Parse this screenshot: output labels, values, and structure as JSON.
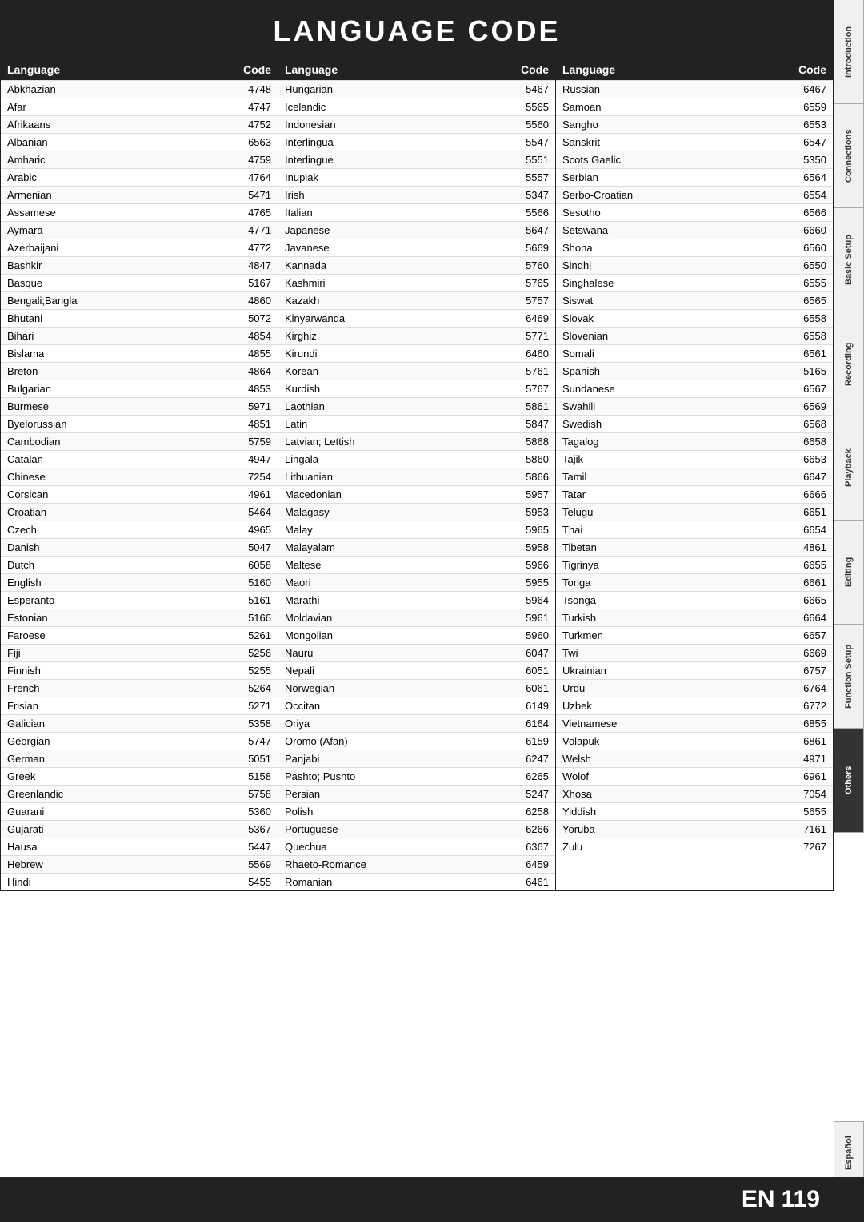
{
  "page": {
    "title": "LANGUAGE CODE",
    "bottom_label": "EN",
    "bottom_number": "119"
  },
  "sidebar": {
    "tabs": [
      {
        "label": "Introduction",
        "active": false
      },
      {
        "label": "Connections",
        "active": false
      },
      {
        "label": "Basic Setup",
        "active": false
      },
      {
        "label": "Recording",
        "active": false
      },
      {
        "label": "Playback",
        "active": false
      },
      {
        "label": "Editing",
        "active": false
      },
      {
        "label": "Function Setup",
        "active": false
      },
      {
        "label": "Others",
        "active": true
      },
      {
        "label": "Español",
        "active": false
      }
    ]
  },
  "columns": [
    {
      "header_lang": "Language",
      "header_code": "Code",
      "rows": [
        {
          "lang": "Abkhazian",
          "code": "4748"
        },
        {
          "lang": "Afar",
          "code": "4747"
        },
        {
          "lang": "Afrikaans",
          "code": "4752"
        },
        {
          "lang": "Albanian",
          "code": "6563"
        },
        {
          "lang": "Amharic",
          "code": "4759"
        },
        {
          "lang": "Arabic",
          "code": "4764"
        },
        {
          "lang": "Armenian",
          "code": "5471"
        },
        {
          "lang": "Assamese",
          "code": "4765"
        },
        {
          "lang": "Aymara",
          "code": "4771"
        },
        {
          "lang": "Azerbaijani",
          "code": "4772"
        },
        {
          "lang": "Bashkir",
          "code": "4847"
        },
        {
          "lang": "Basque",
          "code": "5167"
        },
        {
          "lang": "Bengali;Bangla",
          "code": "4860"
        },
        {
          "lang": "Bhutani",
          "code": "5072"
        },
        {
          "lang": "Bihari",
          "code": "4854"
        },
        {
          "lang": "Bislama",
          "code": "4855"
        },
        {
          "lang": "Breton",
          "code": "4864"
        },
        {
          "lang": "Bulgarian",
          "code": "4853"
        },
        {
          "lang": "Burmese",
          "code": "5971"
        },
        {
          "lang": "Byelorussian",
          "code": "4851"
        },
        {
          "lang": "Cambodian",
          "code": "5759"
        },
        {
          "lang": "Catalan",
          "code": "4947"
        },
        {
          "lang": "Chinese",
          "code": "7254"
        },
        {
          "lang": "Corsican",
          "code": "4961"
        },
        {
          "lang": "Croatian",
          "code": "5464"
        },
        {
          "lang": "Czech",
          "code": "4965"
        },
        {
          "lang": "Danish",
          "code": "5047"
        },
        {
          "lang": "Dutch",
          "code": "6058"
        },
        {
          "lang": "English",
          "code": "5160"
        },
        {
          "lang": "Esperanto",
          "code": "5161"
        },
        {
          "lang": "Estonian",
          "code": "5166"
        },
        {
          "lang": "Faroese",
          "code": "5261"
        },
        {
          "lang": "Fiji",
          "code": "5256"
        },
        {
          "lang": "Finnish",
          "code": "5255"
        },
        {
          "lang": "French",
          "code": "5264"
        },
        {
          "lang": "Frisian",
          "code": "5271"
        },
        {
          "lang": "Galician",
          "code": "5358"
        },
        {
          "lang": "Georgian",
          "code": "5747"
        },
        {
          "lang": "German",
          "code": "5051"
        },
        {
          "lang": "Greek",
          "code": "5158"
        },
        {
          "lang": "Greenlandic",
          "code": "5758"
        },
        {
          "lang": "Guarani",
          "code": "5360"
        },
        {
          "lang": "Gujarati",
          "code": "5367"
        },
        {
          "lang": "Hausa",
          "code": "5447"
        },
        {
          "lang": "Hebrew",
          "code": "5569"
        },
        {
          "lang": "Hindi",
          "code": "5455"
        }
      ]
    },
    {
      "header_lang": "Language",
      "header_code": "Code",
      "rows": [
        {
          "lang": "Hungarian",
          "code": "5467"
        },
        {
          "lang": "Icelandic",
          "code": "5565"
        },
        {
          "lang": "Indonesian",
          "code": "5560"
        },
        {
          "lang": "Interlingua",
          "code": "5547"
        },
        {
          "lang": "Interlingue",
          "code": "5551"
        },
        {
          "lang": "Inupiak",
          "code": "5557"
        },
        {
          "lang": "Irish",
          "code": "5347"
        },
        {
          "lang": "Italian",
          "code": "5566"
        },
        {
          "lang": "Japanese",
          "code": "5647"
        },
        {
          "lang": "Javanese",
          "code": "5669"
        },
        {
          "lang": "Kannada",
          "code": "5760"
        },
        {
          "lang": "Kashmiri",
          "code": "5765"
        },
        {
          "lang": "Kazakh",
          "code": "5757"
        },
        {
          "lang": "Kinyarwanda",
          "code": "6469"
        },
        {
          "lang": "Kirghiz",
          "code": "5771"
        },
        {
          "lang": "Kirundi",
          "code": "6460"
        },
        {
          "lang": "Korean",
          "code": "5761"
        },
        {
          "lang": "Kurdish",
          "code": "5767"
        },
        {
          "lang": "Laothian",
          "code": "5861"
        },
        {
          "lang": "Latin",
          "code": "5847"
        },
        {
          "lang": "Latvian; Lettish",
          "code": "5868"
        },
        {
          "lang": "Lingala",
          "code": "5860"
        },
        {
          "lang": "Lithuanian",
          "code": "5866"
        },
        {
          "lang": "Macedonian",
          "code": "5957"
        },
        {
          "lang": "Malagasy",
          "code": "5953"
        },
        {
          "lang": "Malay",
          "code": "5965"
        },
        {
          "lang": "Malayalam",
          "code": "5958"
        },
        {
          "lang": "Maltese",
          "code": "5966"
        },
        {
          "lang": "Maori",
          "code": "5955"
        },
        {
          "lang": "Marathi",
          "code": "5964"
        },
        {
          "lang": "Moldavian",
          "code": "5961"
        },
        {
          "lang": "Mongolian",
          "code": "5960"
        },
        {
          "lang": "Nauru",
          "code": "6047"
        },
        {
          "lang": "Nepali",
          "code": "6051"
        },
        {
          "lang": "Norwegian",
          "code": "6061"
        },
        {
          "lang": "Occitan",
          "code": "6149"
        },
        {
          "lang": "Oriya",
          "code": "6164"
        },
        {
          "lang": "Oromo (Afan)",
          "code": "6159"
        },
        {
          "lang": "Panjabi",
          "code": "6247"
        },
        {
          "lang": "Pashto; Pushto",
          "code": "6265"
        },
        {
          "lang": "Persian",
          "code": "5247"
        },
        {
          "lang": "Polish",
          "code": "6258"
        },
        {
          "lang": "Portuguese",
          "code": "6266"
        },
        {
          "lang": "Quechua",
          "code": "6367"
        },
        {
          "lang": "Rhaeto-Romance",
          "code": "6459"
        },
        {
          "lang": "Romanian",
          "code": "6461"
        }
      ]
    },
    {
      "header_lang": "Language",
      "header_code": "Code",
      "rows": [
        {
          "lang": "Russian",
          "code": "6467"
        },
        {
          "lang": "Samoan",
          "code": "6559"
        },
        {
          "lang": "Sangho",
          "code": "6553"
        },
        {
          "lang": "Sanskrit",
          "code": "6547"
        },
        {
          "lang": "Scots Gaelic",
          "code": "5350"
        },
        {
          "lang": "Serbian",
          "code": "6564"
        },
        {
          "lang": "Serbo-Croatian",
          "code": "6554"
        },
        {
          "lang": "Sesotho",
          "code": "6566"
        },
        {
          "lang": "Setswana",
          "code": "6660"
        },
        {
          "lang": "Shona",
          "code": "6560"
        },
        {
          "lang": "Sindhi",
          "code": "6550"
        },
        {
          "lang": "Singhalese",
          "code": "6555"
        },
        {
          "lang": "Siswat",
          "code": "6565"
        },
        {
          "lang": "Slovak",
          "code": "6558"
        },
        {
          "lang": "Slovenian",
          "code": "6558"
        },
        {
          "lang": "Somali",
          "code": "6561"
        },
        {
          "lang": "Spanish",
          "code": "5165"
        },
        {
          "lang": "Sundanese",
          "code": "6567"
        },
        {
          "lang": "Swahili",
          "code": "6569"
        },
        {
          "lang": "Swedish",
          "code": "6568"
        },
        {
          "lang": "Tagalog",
          "code": "6658"
        },
        {
          "lang": "Tajik",
          "code": "6653"
        },
        {
          "lang": "Tamil",
          "code": "6647"
        },
        {
          "lang": "Tatar",
          "code": "6666"
        },
        {
          "lang": "Telugu",
          "code": "6651"
        },
        {
          "lang": "Thai",
          "code": "6654"
        },
        {
          "lang": "Tibetan",
          "code": "4861"
        },
        {
          "lang": "Tigrinya",
          "code": "6655"
        },
        {
          "lang": "Tonga",
          "code": "6661"
        },
        {
          "lang": "Tsonga",
          "code": "6665"
        },
        {
          "lang": "Turkish",
          "code": "6664"
        },
        {
          "lang": "Turkmen",
          "code": "6657"
        },
        {
          "lang": "Twi",
          "code": "6669"
        },
        {
          "lang": "Ukrainian",
          "code": "6757"
        },
        {
          "lang": "Urdu",
          "code": "6764"
        },
        {
          "lang": "Uzbek",
          "code": "6772"
        },
        {
          "lang": "Vietnamese",
          "code": "6855"
        },
        {
          "lang": "Volapuk",
          "code": "6861"
        },
        {
          "lang": "Welsh",
          "code": "4971"
        },
        {
          "lang": "Wolof",
          "code": "6961"
        },
        {
          "lang": "Xhosa",
          "code": "7054"
        },
        {
          "lang": "Yiddish",
          "code": "5655"
        },
        {
          "lang": "Yoruba",
          "code": "7161"
        },
        {
          "lang": "Zulu",
          "code": "7267"
        }
      ]
    }
  ]
}
